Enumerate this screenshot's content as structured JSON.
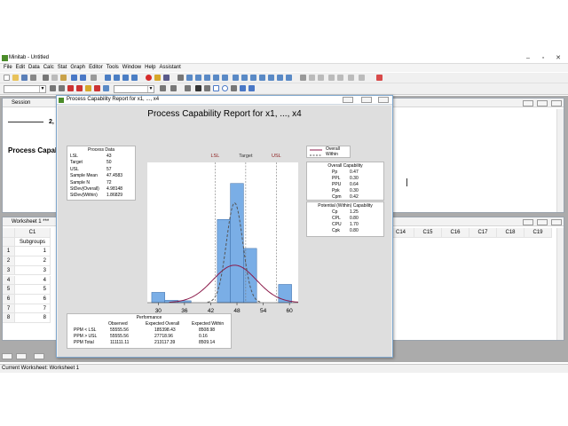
{
  "app": {
    "title": "Minitab - Untitled",
    "colors": {
      "chrome": "#f0f0f0",
      "mdi_bg": "#ababab",
      "accent": "#1f5ca8"
    }
  },
  "menu": [
    "File",
    "Edit",
    "Data",
    "Calc",
    "Stat",
    "Graph",
    "Editor",
    "Tools",
    "Window",
    "Help",
    "Assistant"
  ],
  "session": {
    "title": "Session",
    "heading_partial": "Process Capab",
    "number_partial": "2,"
  },
  "report_window": {
    "title": "Process Capability Report for x1, ..., x4"
  },
  "chart_data": {
    "type": "bar",
    "title": "Process Capability Report for x1, ..., x4",
    "xticks": [
      "30",
      "36",
      "42",
      "48",
      "54",
      "60"
    ],
    "xlim": [
      27.5,
      62
    ],
    "ylim": [
      0,
      0.3
    ],
    "bins": [
      {
        "from": 28.5,
        "to": 31.5,
        "density": 0.022
      },
      {
        "from": 31.5,
        "to": 34.5,
        "density": 0.005
      },
      {
        "from": 34.5,
        "to": 37.5,
        "density": 0.004
      },
      {
        "from": 43.5,
        "to": 46.5,
        "density": 0.178
      },
      {
        "from": 46.5,
        "to": 49.5,
        "density": 0.255
      },
      {
        "from": 49.5,
        "to": 52.5,
        "density": 0.116
      },
      {
        "from": 57.5,
        "to": 60.5,
        "density": 0.039
      }
    ],
    "reference_lines": [
      {
        "label": "LSL",
        "value": 43,
        "color": "#8b1a1a"
      },
      {
        "label": "Target",
        "value": 50,
        "color": "#333333"
      },
      {
        "label": "USL",
        "value": 57,
        "color": "#8b1a1a"
      }
    ],
    "curves": {
      "overall": {
        "mean": 47.4583,
        "sd": 4.98148,
        "color": "#8b1a4a"
      },
      "within": {
        "mean": 47.4583,
        "sd": 1.86829,
        "color": "#555555"
      }
    },
    "legend": [
      {
        "name": "Overall",
        "style": "solid",
        "color": "#8b1a4a"
      },
      {
        "name": "Within",
        "style": "dashed",
        "color": "#555555"
      }
    ],
    "bar_color": "#7aaee6"
  },
  "process_data": {
    "title": "Process Data",
    "rows": [
      {
        "label": "LSL",
        "value": "43"
      },
      {
        "label": "Target",
        "value": "50"
      },
      {
        "label": "USL",
        "value": "57"
      },
      {
        "label": "Sample Mean",
        "value": "47.4583"
      },
      {
        "label": "Sample N",
        "value": "72"
      },
      {
        "label": "StDev(Overall)",
        "value": "4.98148"
      },
      {
        "label": "StDev(Within)",
        "value": "1.86829"
      }
    ]
  },
  "overall_capability": {
    "title": "Overall Capability",
    "rows": [
      {
        "label": "Pp",
        "value": "0.47"
      },
      {
        "label": "PPL",
        "value": "0.30"
      },
      {
        "label": "PPU",
        "value": "0.64"
      },
      {
        "label": "Ppk",
        "value": "0.30"
      },
      {
        "label": "Cpm",
        "value": "0.42"
      }
    ]
  },
  "within_capability": {
    "title": "Potential (Within) Capability",
    "rows": [
      {
        "label": "Cp",
        "value": "1.25"
      },
      {
        "label": "CPL",
        "value": "0.80"
      },
      {
        "label": "CPU",
        "value": "1.70"
      },
      {
        "label": "Cpk",
        "value": "0.80"
      }
    ]
  },
  "performance": {
    "title": "Performance",
    "headers": [
      "Observed",
      "Expected Overall",
      "Expected Within"
    ],
    "rows": [
      {
        "label": "PPM < LSL",
        "values": [
          "55555.56",
          "185398.43",
          "8508.98"
        ]
      },
      {
        "label": "PPM > USL",
        "values": [
          "55555.56",
          "27718.96",
          "0.16"
        ]
      },
      {
        "label": "PPM Total",
        "values": [
          "111111.11",
          "213117.39",
          "8509.14"
        ]
      }
    ]
  },
  "worksheet": {
    "title": "Worksheet 1 ***",
    "row_header_col": "C1",
    "col1_name": "Subgroups",
    "columns_right": [
      "C14",
      "C15",
      "C16",
      "C17",
      "C18",
      "C19"
    ],
    "rows": [
      {
        "n": "1",
        "v": "1"
      },
      {
        "n": "2",
        "v": "2"
      },
      {
        "n": "3",
        "v": "3"
      },
      {
        "n": "4",
        "v": "4"
      },
      {
        "n": "5",
        "v": "5"
      },
      {
        "n": "6",
        "v": "6"
      },
      {
        "n": "7",
        "v": "7"
      },
      {
        "n": "8",
        "v": "8"
      }
    ]
  },
  "status": {
    "text": "Current Worksheet: Worksheet 1"
  }
}
